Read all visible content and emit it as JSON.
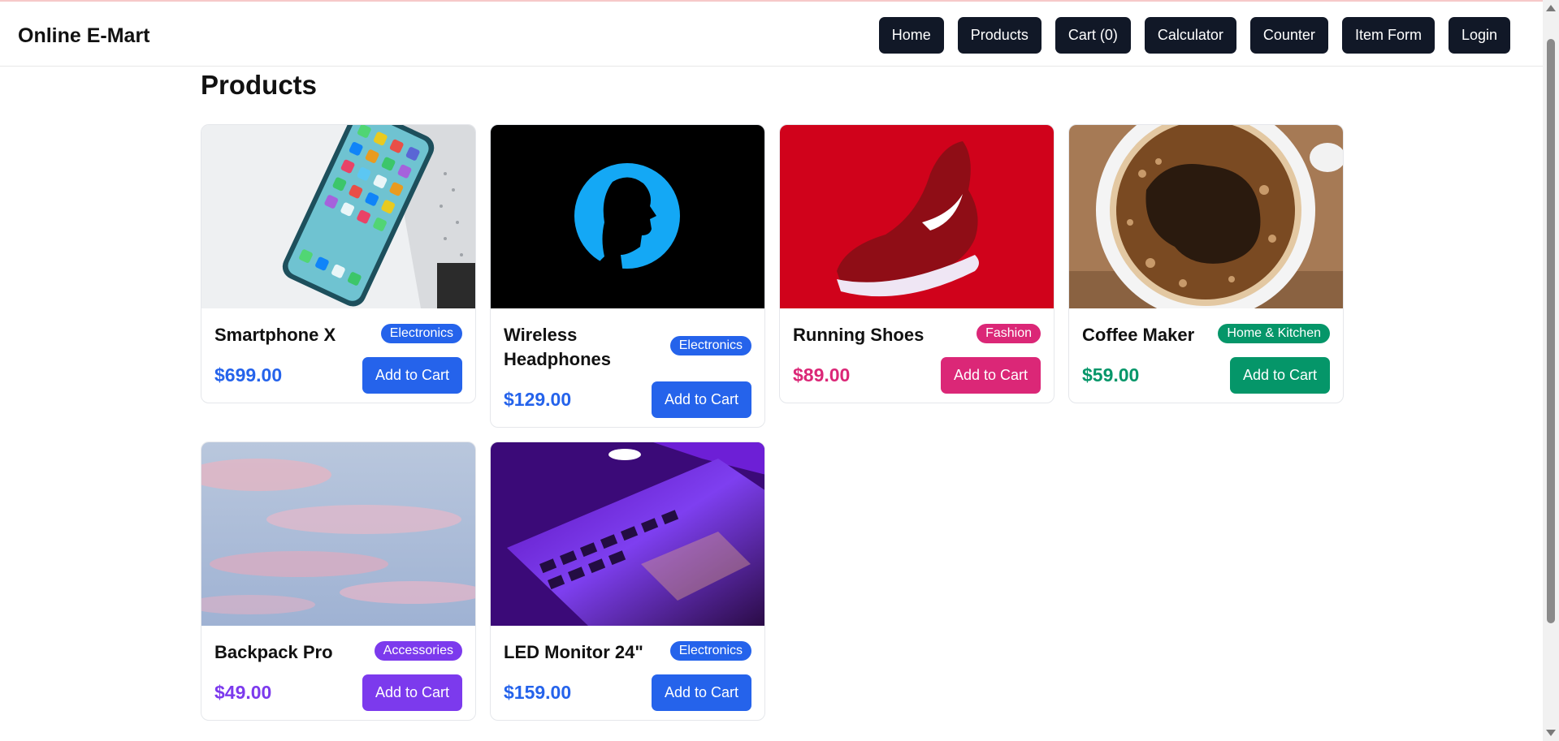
{
  "app": {
    "brand": "Online E-Mart"
  },
  "nav": {
    "home": "Home",
    "products": "Products",
    "cart": "Cart (0)",
    "calculator": "Calculator",
    "counter": "Counter",
    "item_form": "Item Form",
    "login": "Login"
  },
  "page": {
    "title": "Products"
  },
  "products": [
    {
      "name": "Smartphone X",
      "category": "Electronics",
      "price": "$699.00",
      "button": "Add to Cart",
      "accent": "#2563eb"
    },
    {
      "name": "Wireless Headphones",
      "category": "Electronics",
      "price": "$129.00",
      "button": "Add to Cart",
      "accent": "#2563eb"
    },
    {
      "name": "Running Shoes",
      "category": "Fashion",
      "price": "$89.00",
      "button": "Add to Cart",
      "accent": "#db2777"
    },
    {
      "name": "Coffee Maker",
      "category": "Home & Kitchen",
      "price": "$59.00",
      "button": "Add to Cart",
      "accent": "#059669"
    },
    {
      "name": "Backpack Pro",
      "category": "Accessories",
      "price": "$49.00",
      "button": "Add to Cart",
      "accent": "#7c3aed"
    },
    {
      "name": "LED Monitor 24\"",
      "category": "Electronics",
      "price": "$159.00",
      "button": "Add to Cart",
      "accent": "#2563eb"
    }
  ]
}
